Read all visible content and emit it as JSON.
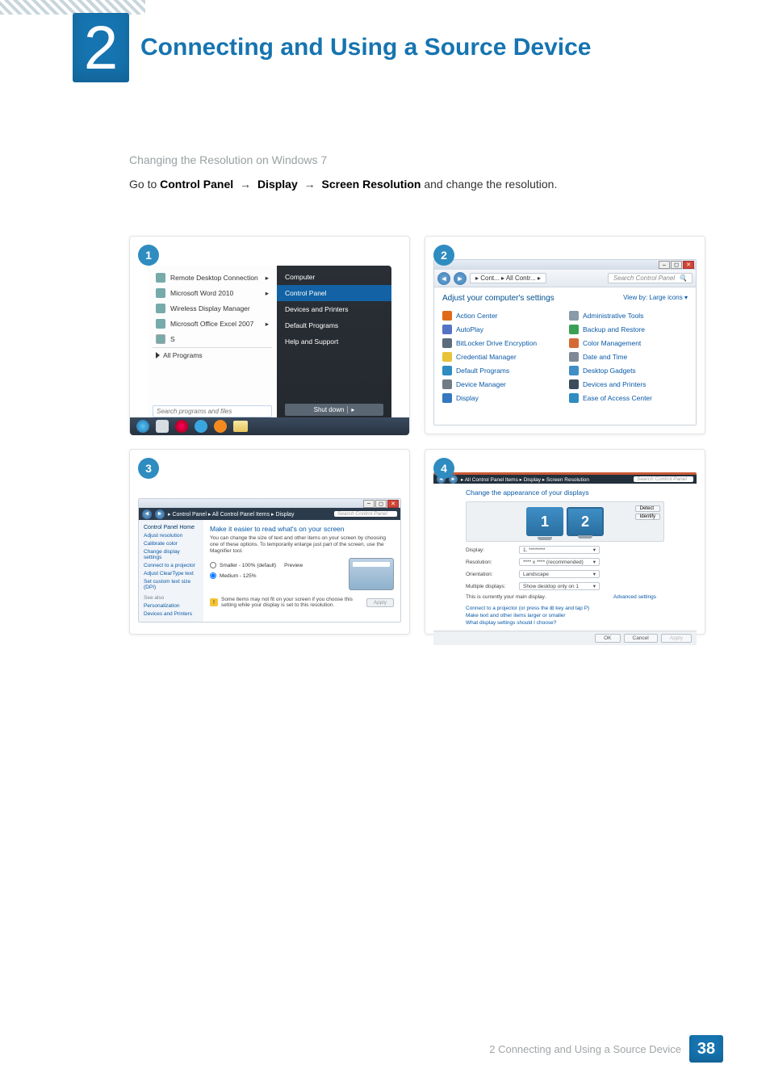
{
  "chapter_number": "2",
  "chapter_title": "Connecting and Using a Source Device",
  "sub_heading": "Changing the Resolution on Windows 7",
  "instruction_prefix": "Go to ",
  "instruction_path": [
    "Control Panel",
    "Display",
    "Screen Resolution"
  ],
  "instruction_suffix": " and change the resolution.",
  "arrow": "→",
  "steps": {
    "1": "1",
    "2": "2",
    "3": "3",
    "4": "4"
  },
  "start_menu": {
    "left_programs": [
      "Remote Desktop Connection",
      "Microsoft Word 2010",
      "Wireless Display Manager",
      "Microsoft Office Excel 2007",
      "S"
    ],
    "all_programs": "All Programs",
    "search_placeholder": "Search programs and files",
    "right_items": [
      "Computer",
      "Control Panel",
      "Devices and Printers",
      "Default Programs",
      "Help and Support"
    ],
    "shutdown": "Shut down"
  },
  "control_panel": {
    "crumb": "▸ Cont... ▸ All Contr... ▸",
    "search_placeholder": "Search Control Panel",
    "heading": "Adjust your computer's settings",
    "view_by": "View by:  Large icons ▾",
    "items_left": [
      "Action Center",
      "AutoPlay",
      "BitLocker Drive Encryption",
      "Credential Manager",
      "Default Programs",
      "Device Manager",
      "Display"
    ],
    "items_right": [
      "Administrative Tools",
      "Backup and Restore",
      "Color Management",
      "Date and Time",
      "Desktop Gadgets",
      "Devices and Printers",
      "Ease of Access Center"
    ],
    "item_colors_left": [
      "#e06a1a",
      "#5573c6",
      "#5a6c7c",
      "#e7c23a",
      "#2e8cc0",
      "#6f7b85",
      "#3478c0"
    ],
    "item_colors_right": [
      "#8a9aa7",
      "#3aa056",
      "#d66a37",
      "#7e8995",
      "#3f8ec4",
      "#3a4b5c",
      "#2e8cc0"
    ]
  },
  "display_settings": {
    "crumb": "▸ Control Panel ▸ All Control Panel Items ▸ Display",
    "search_placeholder": "Search Control Panel",
    "side": {
      "home": "Control Panel Home",
      "links": [
        "Adjust resolution",
        "Calibrate color",
        "Change display settings",
        "Connect to a projector",
        "Adjust ClearType text",
        "Set custom text size (DPI)"
      ],
      "see_also": "See also",
      "see_links": [
        "Personalization",
        "Devices and Printers"
      ]
    },
    "main": {
      "title": "Make it easier to read what's on your screen",
      "desc": "You can change the size of text and other items on your screen by choosing one of these options. To temporarily enlarge just part of the screen, use the Magnifier tool.",
      "magnifier_link": "Magnifier",
      "radio1": "Smaller - 100% (default)",
      "preview_label": "Preview",
      "radio2": "Medium - 125%",
      "warning": "Some items may not fit on your screen if you choose this setting while your display is set to this resolution.",
      "apply": "Apply"
    }
  },
  "screen_resolution": {
    "crumb": "▸ All Control Panel Items ▸ Display ▸ Screen Resolution",
    "search_placeholder": "Search Control Panel",
    "title": "Change the appearance of your displays",
    "detect": "Detect",
    "identify": "Identify",
    "monitor_labels": [
      "1",
      "2"
    ],
    "fields": {
      "display": {
        "label": "Display:",
        "value": "1. ********"
      },
      "resolution": {
        "label": "Resolution:",
        "value": "**** x **** (recommended)"
      },
      "orientation": {
        "label": "Orientation:",
        "value": "Landscape"
      },
      "multiple": {
        "label": "Multiple displays:",
        "value": "Show desktop only on 1"
      }
    },
    "main_display_note": "This is currently your main display.",
    "advanced": "Advanced settings",
    "links": [
      "Connect to a projector (or press the ⊞ key and tap P)",
      "Make text and other items larger or smaller",
      "What display settings should I choose?"
    ],
    "buttons": {
      "ok": "OK",
      "cancel": "Cancel",
      "apply": "Apply"
    }
  },
  "footer": {
    "text": "2 Connecting and Using a Source Device",
    "page": "38"
  }
}
